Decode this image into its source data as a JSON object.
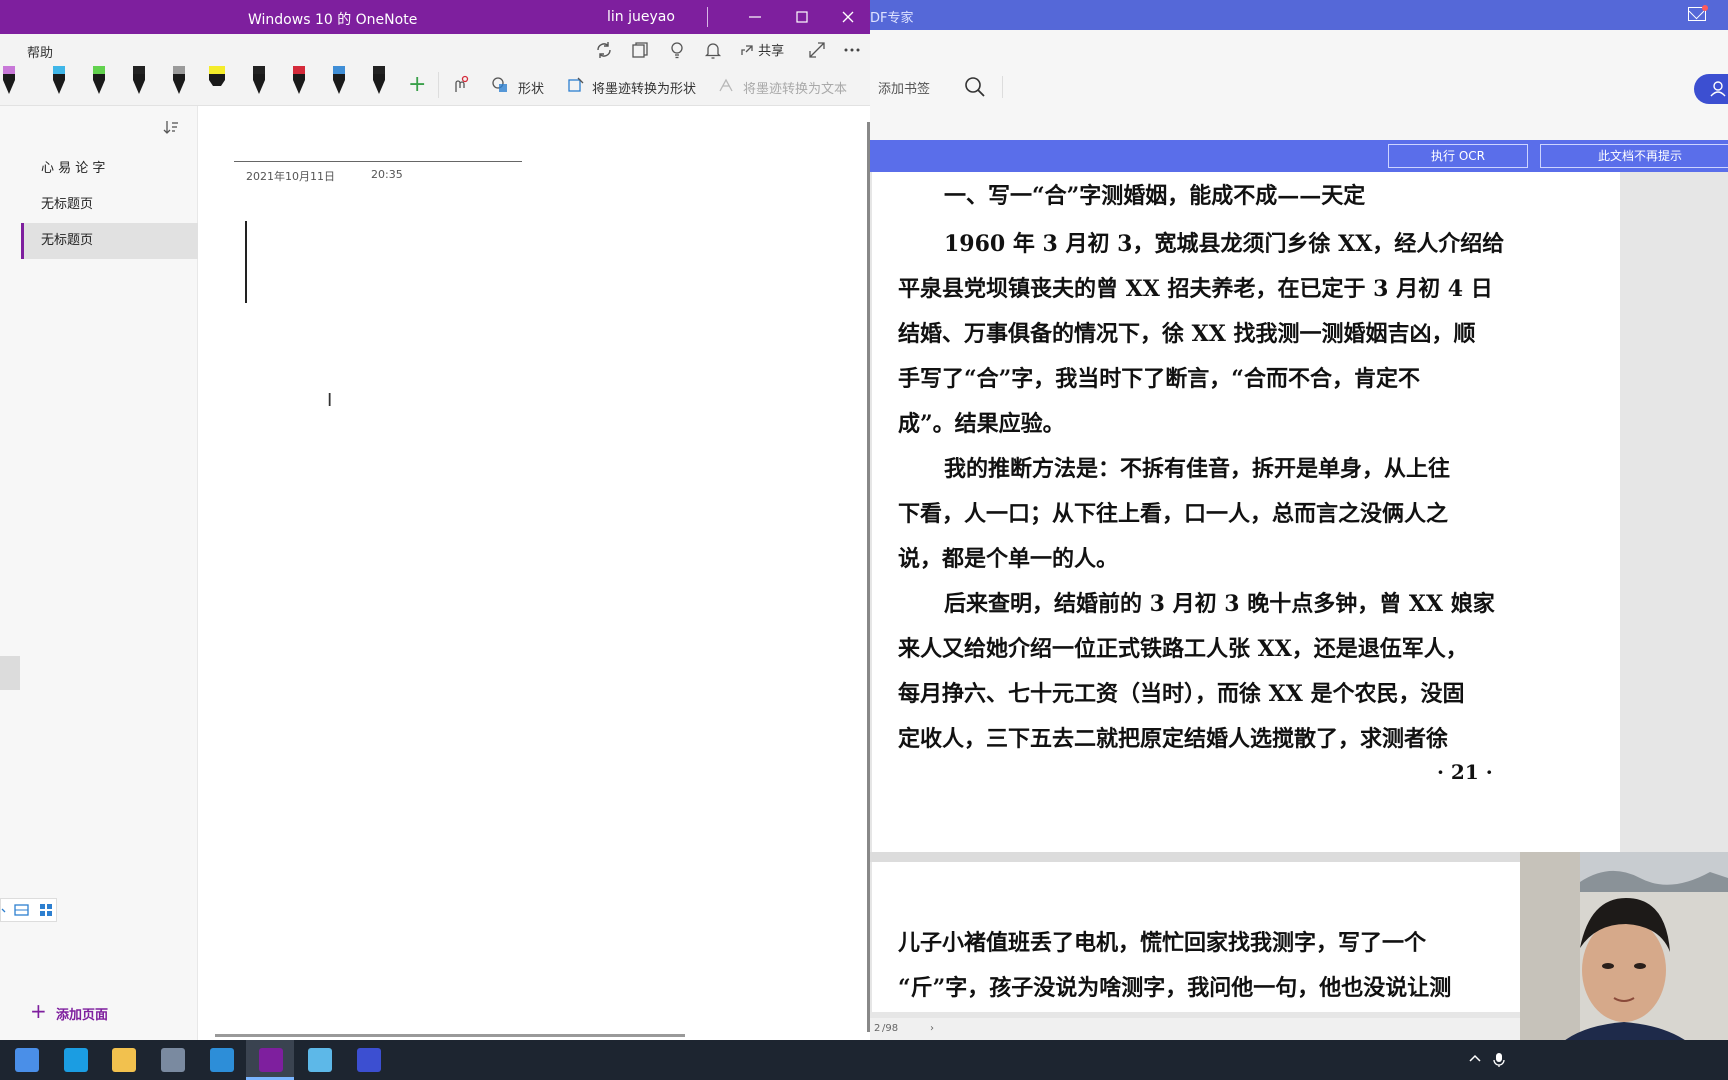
{
  "onenote": {
    "title": "Windows 10 的 OneNote",
    "user": "lin jueyao",
    "ribbon_tab": "帮助",
    "share_label": "共享",
    "shape_label": "形状",
    "ink_to_shape_label": "将墨迹转换为形状",
    "ink_to_text_label": "将墨迹转换为文本",
    "pens": [
      {
        "icon": "pen-icon",
        "color": "#c878d8"
      },
      {
        "icon": "pen-icon",
        "color": "#3fb6e8"
      },
      {
        "icon": "pen-icon",
        "color": "#62d24e"
      },
      {
        "icon": "pen-icon",
        "color": "#222222"
      },
      {
        "icon": "pen-icon",
        "color": "#9a9a9a"
      },
      {
        "icon": "highlighter-icon",
        "color": "#f4ec2a"
      },
      {
        "icon": "pen-icon",
        "color": "#222222"
      },
      {
        "icon": "pen-icon",
        "color": "#d42a3a"
      },
      {
        "icon": "pen-icon",
        "color": "#3f8ed6"
      },
      {
        "icon": "pen-icon",
        "color": "#222222"
      }
    ],
    "pages": [
      "心 易 论 字",
      "无标题页",
      "无标题页"
    ],
    "active_page_index": 2,
    "add_page_label": "添加页面",
    "note_date": "2021年10月11日",
    "note_time": "20:35",
    "accent": "#7e1f9e"
  },
  "pdf": {
    "app_title_fragment": "DF专家",
    "add_bookmark_label": "添加书签",
    "ocr_button": "执行 OCR",
    "dismiss_button": "此文档不再提示",
    "page1_lines": [
      "一、写一“合”字测婚姻，能成不成——天定",
      "1960 年 3 月初 3，宽城县龙须门乡徐 XX，经人介绍给",
      "平泉县党坝镇丧夫的曾 XX 招夫养老，在已定于 3 月初 4 日",
      "结婚、万事俱备的情况下，徐 XX 找我测一测婚姻吉凶，顺",
      "手写了“合”字，我当时下了断言，“合而不合，肯定不",
      "成”。结果应验。",
      "我的推断方法是：不拆有佳音，拆开是单身，从上往",
      "下看，人一口；从下往上看，口一人，总而言之没俩人之",
      "说，都是个单一的人。",
      "后来查明，结婚前的 3 月初 3 晚十点多钟，曾 XX 娘家",
      "来人又给她介绍一位正式铁路工人张 XX，还是退伍军人，",
      "每月挣六、七十元工资（当时），而徐 XX 是个农民，没固",
      "定收人，三下五去二就把原定结婚人选搅散了，求测者徐"
    ],
    "page1_number": "· 21 ·",
    "page2_lines": [
      "儿子小褚值班丢了电机，慌忙回家找我测字，写了一个",
      "“斤”字，孩子没说为啥测字，我问他一句，他也没说让测"
    ],
    "status_page": "2",
    "status_total": "/98",
    "status_next": "›",
    "accent": "#5a6eea"
  },
  "taskbar": {
    "apps": [
      {
        "name": "tb-start-app",
        "icon": "feather-icon",
        "color": "#4a8fe8"
      },
      {
        "name": "tb-edge",
        "icon": "edge-icon",
        "color": "#1b9de2"
      },
      {
        "name": "tb-explorer",
        "icon": "folder-icon",
        "color": "#f2c14e"
      },
      {
        "name": "tb-calculator",
        "icon": "calculator-icon",
        "color": "#7a8aa0"
      },
      {
        "name": "tb-app-browser",
        "icon": "browser-icon",
        "color": "#2d8ed8"
      },
      {
        "name": "tb-onenote",
        "icon": "onenote-icon",
        "color": "#7e1f9e"
      },
      {
        "name": "tb-image-app",
        "icon": "image-app-icon",
        "color": "#5db8e8"
      },
      {
        "name": "tb-pdf-app",
        "icon": "pdf-app-icon",
        "color": "#3c4fd1"
      }
    ],
    "active_app": "tb-onenote"
  }
}
